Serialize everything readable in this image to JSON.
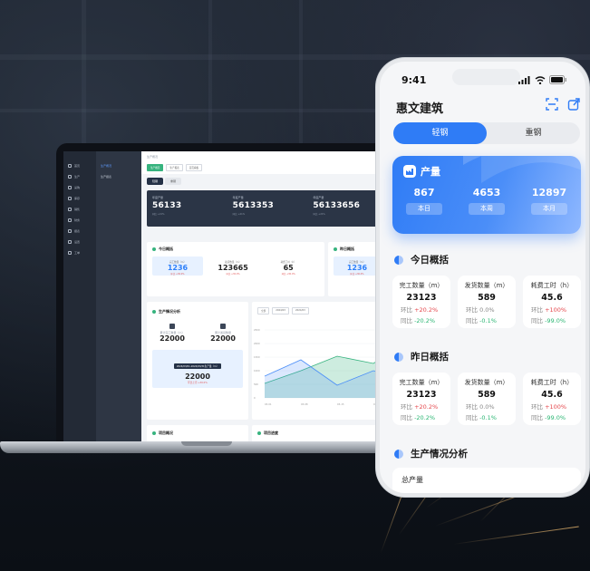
{
  "laptop": {
    "nav_items": [
      "首页",
      "生产",
      "采购",
      "库存",
      "销售",
      "财务",
      "报表",
      "设置",
      "工单"
    ],
    "sub_items": [
      "生产概况",
      "生产报表"
    ],
    "breadcrumb": "生产概况",
    "tabs": [
      "生产概况",
      "生产报表",
      "首页看板"
    ],
    "switch": [
      "轻钢",
      "重钢"
    ],
    "totals": [
      {
        "label": "年度产量",
        "value": "56133",
        "sub": "同比 +21%"
      },
      {
        "label": "年度产量",
        "value": "5613353",
        "sub": "同比 +21%"
      },
      {
        "label": "年度产量",
        "value": "56133656",
        "sub": "同比 +21%"
      }
    ],
    "today_title": "今日概括",
    "yesterday_title": "昨日概括",
    "today_metrics": [
      {
        "label": "完工数量（m）",
        "value": "1236",
        "sub": "环比 +30.0%"
      },
      {
        "label": "发货数量（m）",
        "value": "123665",
        "sub": "环比 +30.0%"
      },
      {
        "label": "耗费工时（h）",
        "value": "65",
        "sub": "环比 +30.0%"
      }
    ],
    "yesterday_value": "1236",
    "analysis_title": "生产情况分析",
    "analysis_a_label": "累计完工数量（m）",
    "analysis_a_value": "22000",
    "analysis_b_label": "累计发货数量",
    "analysis_b_value": "22000",
    "range_pill": "2024/03/01-2024/03/31生产量（m）",
    "range_value": "22000",
    "range_sub": "环比上月 +30.0%",
    "chart_filter": [
      "全部",
      "2024/03",
      "2024/03"
    ],
    "chart_xlabels": [
      "03-01",
      "03-08",
      "03-15",
      "03-22"
    ],
    "chart_ylabels": [
      "2500",
      "2000",
      "1500",
      "1000",
      "500",
      "0"
    ],
    "bottom_left": "项目概况",
    "bottom_right": "项目进度"
  },
  "phone": {
    "time": "9:41",
    "title": "惠文建筑",
    "segments": [
      "轻钢",
      "重钢"
    ],
    "card": {
      "title": "产量",
      "cols": [
        {
          "value": "867",
          "button": "本日"
        },
        {
          "value": "4653",
          "button": "本周"
        },
        {
          "value": "12897",
          "button": "本月"
        }
      ]
    },
    "today": {
      "title": "今日概括",
      "boxes": [
        {
          "label": "完工数量（m）",
          "value": "23123",
          "hb_label": "环比",
          "hb": "+20.2%",
          "hb_color": "red",
          "tb_label": "同比",
          "tb": "-20.2%",
          "tb_color": "green"
        },
        {
          "label": "发货数量（m）",
          "value": "589",
          "hb_label": "环比",
          "hb": "0.0%",
          "hb_color": "gray",
          "tb_label": "同比",
          "tb": "-0.1%",
          "tb_color": "green"
        },
        {
          "label": "耗费工时（h）",
          "value": "45.6",
          "hb_label": "环比",
          "hb": "+100%",
          "hb_color": "red",
          "tb_label": "同比",
          "tb": "-99.0%",
          "tb_color": "green"
        }
      ]
    },
    "yesterday": {
      "title": "昨日概括",
      "boxes": [
        {
          "label": "完工数量（m）",
          "value": "23123",
          "hb_label": "环比",
          "hb": "+20.2%",
          "hb_color": "red",
          "tb_label": "同比",
          "tb": "-20.2%",
          "tb_color": "green"
        },
        {
          "label": "发货数量（m）",
          "value": "589",
          "hb_label": "环比",
          "hb": "0.0%",
          "hb_color": "gray",
          "tb_label": "同比",
          "tb": "-0.1%",
          "tb_color": "green"
        },
        {
          "label": "耗费工时（h）",
          "value": "45.6",
          "hb_label": "环比",
          "hb": "+100%",
          "hb_color": "red",
          "tb_label": "同比",
          "tb": "-99.0%",
          "tb_color": "green"
        }
      ]
    },
    "analysis_title": "生产情况分析",
    "total_label": "总产量"
  },
  "colors": {
    "primary": "#2f7cf6",
    "up": "#e5484d",
    "down": "#2bb673",
    "dark_panel": "#2b3546"
  }
}
